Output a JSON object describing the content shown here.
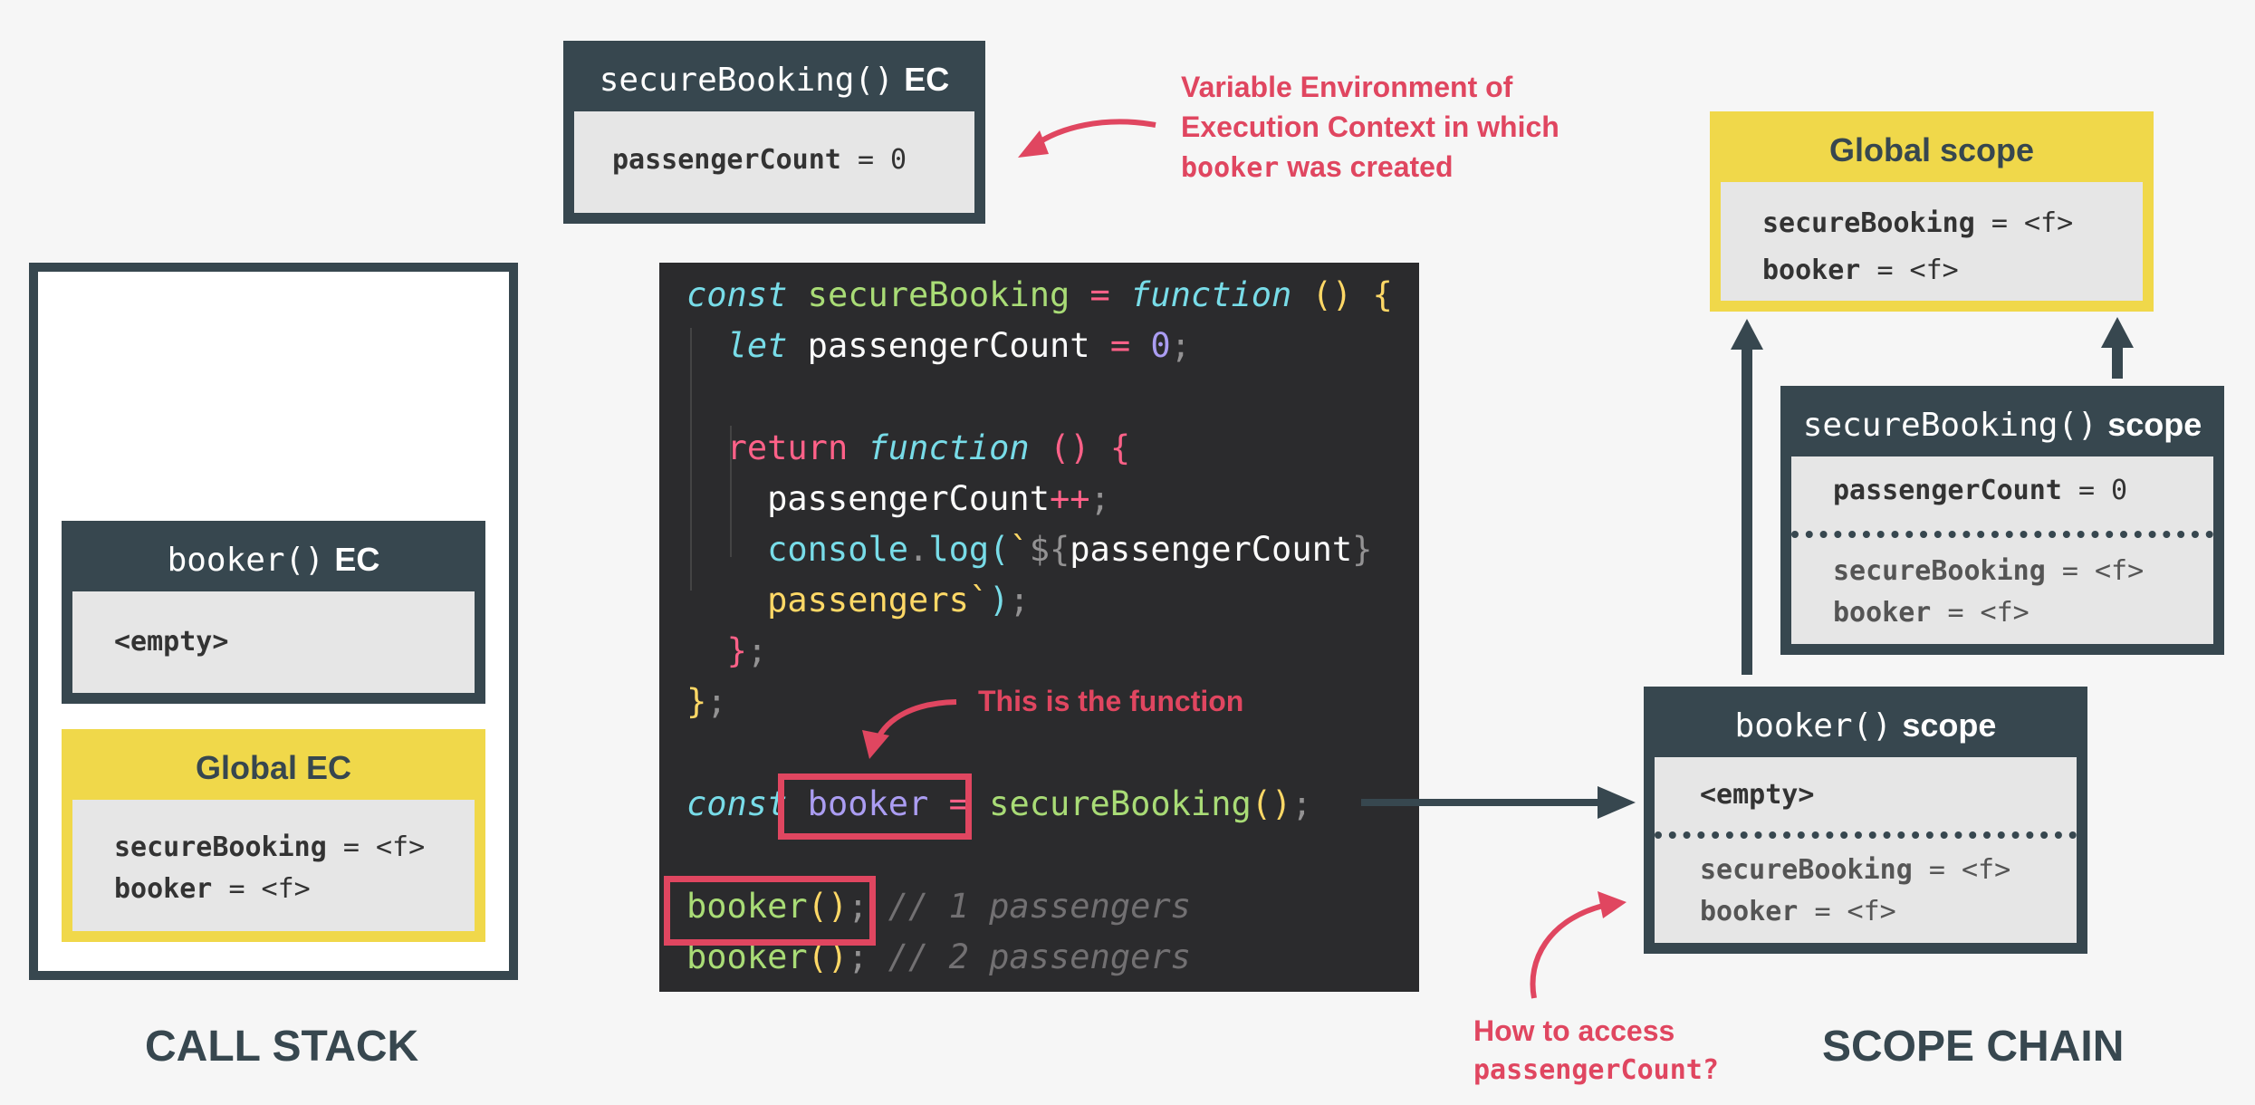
{
  "call_stack": {
    "title": "CALL STACK",
    "booker_ec": {
      "name": "booker()",
      "suffix": "EC",
      "body": "<empty>"
    },
    "global_ec": {
      "title": "Global EC",
      "rows": [
        {
          "key": "secureBooking",
          "val": "= <f>"
        },
        {
          "key": "booker",
          "val": "= <f>"
        }
      ]
    }
  },
  "secure_ec": {
    "name": "secureBooking()",
    "suffix": "EC",
    "key": "passengerCount",
    "val": "= 0"
  },
  "annotations": {
    "variable_env": [
      "Variable Environment of",
      "Execution Context in which",
      "was created"
    ],
    "variable_env_code": "booker",
    "this_is_function": "This is the function",
    "how_to_access": "How to access",
    "how_to_access_code": "passengerCount?"
  },
  "code": {
    "l1": {
      "kw": "const",
      "name": "secureBooking",
      "op": "=",
      "fn": "function",
      "paren": "()",
      "brace": "{"
    },
    "l2": {
      "kw": "let",
      "name": "passengerCount",
      "op": "=",
      "num": "0",
      "semi": ";"
    },
    "l4": {
      "kw": "return",
      "fn": "function",
      "paren": "()",
      "brace": "{"
    },
    "l5": {
      "name": "passengerCount",
      "op": "++",
      "semi": ";"
    },
    "l6": {
      "obj": "console",
      "dot": ".",
      "method": "log",
      "open": "(",
      "tick": "`",
      "interp": "${",
      "var": "passengerCount",
      "close": "}"
    },
    "l7": {
      "str": "passengers",
      "tick": "`",
      "close": ")",
      "semi": ";"
    },
    "l8": {
      "brace": "}",
      "semi": ";"
    },
    "l9": {
      "brace": "}",
      "semi": ";"
    },
    "l11": {
      "kw": "const",
      "name": "booker",
      "op": "=",
      "call": "secureBooking",
      "paren": "()",
      "semi": ";"
    },
    "l13": {
      "call": "booker",
      "paren": "()",
      "semi": ";",
      "comment": "// 1 passengers"
    },
    "l14": {
      "call": "booker",
      "paren": "()",
      "semi": ";",
      "comment": "// 2 passengers"
    }
  },
  "scope_chain": {
    "title": "SCOPE CHAIN",
    "global": {
      "title": "Global scope",
      "rows": [
        {
          "key": "secureBooking",
          "val": "= <f>"
        },
        {
          "key": "booker",
          "val": "= <f>"
        }
      ]
    },
    "secure": {
      "name": "secureBooking()",
      "suffix": "scope",
      "own": {
        "key": "passengerCount",
        "val": "= 0"
      },
      "inherited": [
        {
          "key": "secureBooking",
          "val": "= <f>"
        },
        {
          "key": "booker",
          "val": "= <f>"
        }
      ]
    },
    "booker": {
      "name": "booker()",
      "suffix": "scope",
      "own": "<empty>",
      "inherited": [
        {
          "key": "secureBooking",
          "val": "= <f>"
        },
        {
          "key": "booker",
          "val": "= <f>"
        }
      ]
    }
  },
  "colors": {
    "dark": "#37474f",
    "yellow": "#f0d84a",
    "red": "#e04660",
    "code_bg": "#2b2b2d"
  }
}
